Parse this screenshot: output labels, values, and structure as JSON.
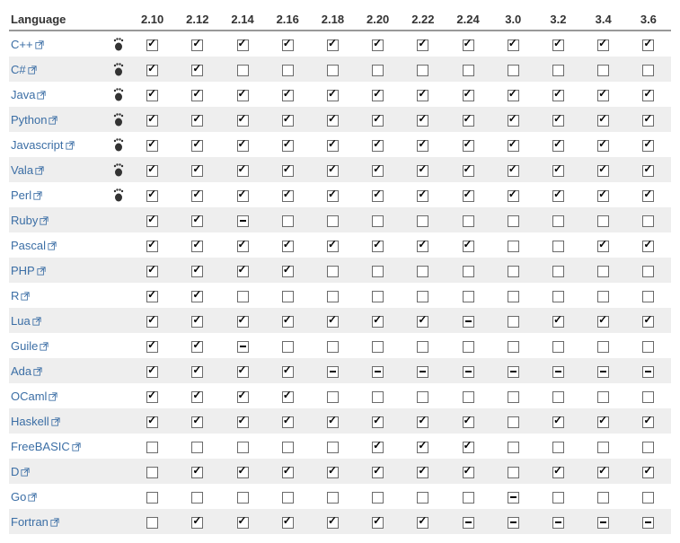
{
  "header": {
    "language": "Language"
  },
  "versions": [
    "2.10",
    "2.12",
    "2.14",
    "2.16",
    "2.18",
    "2.20",
    "2.22",
    "2.24",
    "3.0",
    "3.2",
    "3.4",
    "3.6"
  ],
  "languages": [
    {
      "name": "C++",
      "foot": true,
      "cells": [
        "c",
        "c",
        "c",
        "c",
        "c",
        "c",
        "c",
        "c",
        "c",
        "c",
        "c",
        "c"
      ]
    },
    {
      "name": "C#",
      "foot": true,
      "cells": [
        "c",
        "c",
        "u",
        "u",
        "u",
        "u",
        "u",
        "u",
        "u",
        "u",
        "u",
        "u"
      ]
    },
    {
      "name": "Java",
      "foot": true,
      "cells": [
        "c",
        "c",
        "c",
        "c",
        "c",
        "c",
        "c",
        "c",
        "c",
        "c",
        "c",
        "c"
      ]
    },
    {
      "name": "Python",
      "foot": true,
      "cells": [
        "c",
        "c",
        "c",
        "c",
        "c",
        "c",
        "c",
        "c",
        "c",
        "c",
        "c",
        "c"
      ]
    },
    {
      "name": "Javascript",
      "foot": true,
      "cells": [
        "c",
        "c",
        "c",
        "c",
        "c",
        "c",
        "c",
        "c",
        "c",
        "c",
        "c",
        "c"
      ]
    },
    {
      "name": "Vala",
      "foot": true,
      "cells": [
        "c",
        "c",
        "c",
        "c",
        "c",
        "c",
        "c",
        "c",
        "c",
        "c",
        "c",
        "c"
      ]
    },
    {
      "name": "Perl",
      "foot": true,
      "cells": [
        "c",
        "c",
        "c",
        "c",
        "c",
        "c",
        "c",
        "c",
        "c",
        "c",
        "c",
        "c"
      ]
    },
    {
      "name": "Ruby",
      "foot": false,
      "cells": [
        "c",
        "c",
        "p",
        "u",
        "u",
        "u",
        "u",
        "u",
        "u",
        "u",
        "u",
        "u"
      ]
    },
    {
      "name": "Pascal",
      "foot": false,
      "cells": [
        "c",
        "c",
        "c",
        "c",
        "c",
        "c",
        "c",
        "c",
        "u",
        "u",
        "c",
        "c"
      ]
    },
    {
      "name": "PHP",
      "foot": false,
      "cells": [
        "c",
        "c",
        "c",
        "c",
        "u",
        "u",
        "u",
        "u",
        "u",
        "u",
        "u",
        "u"
      ]
    },
    {
      "name": "R",
      "foot": false,
      "cells": [
        "c",
        "c",
        "u",
        "u",
        "u",
        "u",
        "u",
        "u",
        "u",
        "u",
        "u",
        "u"
      ]
    },
    {
      "name": "Lua",
      "foot": false,
      "cells": [
        "c",
        "c",
        "c",
        "c",
        "c",
        "c",
        "c",
        "p",
        "u",
        "c",
        "c",
        "c"
      ]
    },
    {
      "name": "Guile",
      "foot": false,
      "cells": [
        "c",
        "c",
        "p",
        "u",
        "u",
        "u",
        "u",
        "u",
        "u",
        "u",
        "u",
        "u"
      ]
    },
    {
      "name": "Ada",
      "foot": false,
      "cells": [
        "c",
        "c",
        "c",
        "c",
        "p",
        "p",
        "p",
        "p",
        "p",
        "p",
        "p",
        "p"
      ]
    },
    {
      "name": "OCaml",
      "foot": false,
      "cells": [
        "c",
        "c",
        "c",
        "c",
        "u",
        "u",
        "u",
        "u",
        "u",
        "u",
        "u",
        "u"
      ]
    },
    {
      "name": "Haskell",
      "foot": false,
      "cells": [
        "c",
        "c",
        "c",
        "c",
        "c",
        "c",
        "c",
        "c",
        "u",
        "c",
        "c",
        "c"
      ]
    },
    {
      "name": "FreeBASIC",
      "foot": false,
      "cells": [
        "u",
        "u",
        "u",
        "u",
        "u",
        "c",
        "c",
        "c",
        "u",
        "u",
        "u",
        "u"
      ]
    },
    {
      "name": "D",
      "foot": false,
      "cells": [
        "u",
        "c",
        "c",
        "c",
        "c",
        "c",
        "c",
        "c",
        "u",
        "c",
        "c",
        "c"
      ]
    },
    {
      "name": "Go",
      "foot": false,
      "cells": [
        "u",
        "u",
        "u",
        "u",
        "u",
        "u",
        "u",
        "u",
        "p",
        "u",
        "u",
        "u"
      ]
    },
    {
      "name": "Fortran",
      "foot": false,
      "cells": [
        "u",
        "c",
        "c",
        "c",
        "c",
        "c",
        "c",
        "p",
        "p",
        "p",
        "p",
        "p"
      ]
    }
  ]
}
